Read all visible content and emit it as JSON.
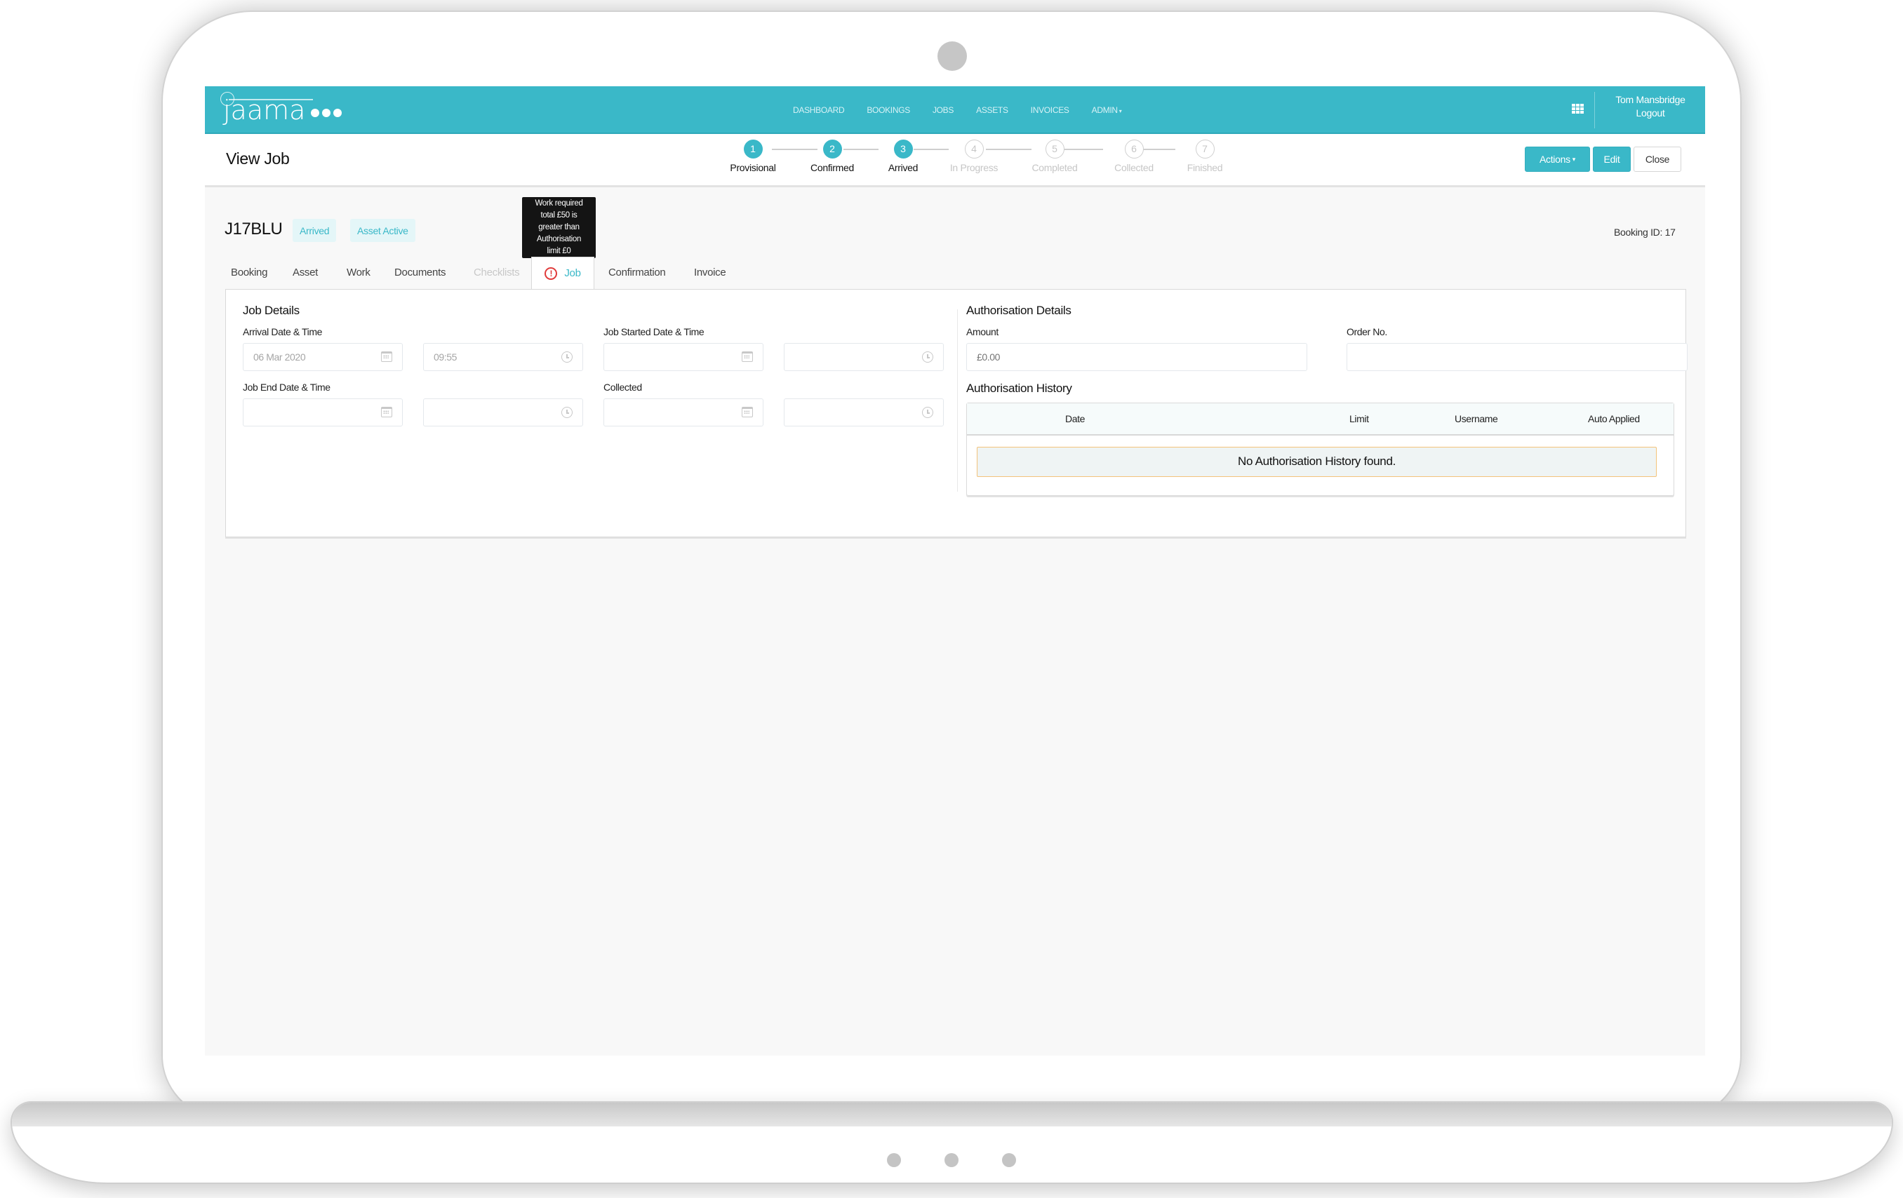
{
  "app": {
    "brand": "jaama",
    "brand_color": "#3ab8c8"
  },
  "nav": {
    "items": [
      {
        "label": "DASHBOARD"
      },
      {
        "label": "BOOKINGS"
      },
      {
        "label": "JOBS"
      },
      {
        "label": "ASSETS"
      },
      {
        "label": "INVOICES"
      },
      {
        "label": "ADMIN",
        "has_dropdown": true
      }
    ],
    "apps_icon": "grid-icon",
    "user_name": "Tom Mansbridge",
    "logout_label": "Logout"
  },
  "subheader": {
    "title": "View Job",
    "steps": [
      {
        "number": "1",
        "label": "Provisional",
        "state": "done"
      },
      {
        "number": "2",
        "label": "Confirmed",
        "state": "done"
      },
      {
        "number": "3",
        "label": "Arrived",
        "state": "done"
      },
      {
        "number": "4",
        "label": "In Progress",
        "state": "todo"
      },
      {
        "number": "5",
        "label": "Completed",
        "state": "todo"
      },
      {
        "number": "6",
        "label": "Collected",
        "state": "todo"
      },
      {
        "number": "7",
        "label": "Finished",
        "state": "todo"
      }
    ],
    "actions_label": "Actions",
    "edit_label": "Edit",
    "close_label": "Close"
  },
  "job": {
    "registration": "J17BLU",
    "badges": [
      "Arrived",
      "Asset Active"
    ],
    "booking_id": "Booking ID: 17",
    "tooltip": [
      "Work required",
      "total £50 is",
      "greater than",
      "Authorisation",
      "limit £0"
    ],
    "tabs": [
      {
        "label": "Booking",
        "state": "normal"
      },
      {
        "label": "Asset",
        "state": "normal"
      },
      {
        "label": "Work",
        "state": "normal"
      },
      {
        "label": "Documents",
        "state": "normal"
      },
      {
        "label": "Checklists",
        "state": "disabled"
      },
      {
        "label": "Job",
        "state": "active",
        "icon": "warning-icon"
      },
      {
        "label": "Confirmation",
        "state": "normal"
      },
      {
        "label": "Invoice",
        "state": "normal"
      }
    ]
  },
  "job_details": {
    "title": "Job Details",
    "arrival_label": "Arrival Date & Time",
    "arrival_date": "06 Mar 2020",
    "arrival_time": "09:55",
    "started_label": "Job Started Date & Time",
    "started_date": "",
    "started_time": "",
    "end_label": "Job End Date & Time",
    "end_date": "",
    "end_time": "",
    "collected_label": "Collected",
    "collected_date": "",
    "collected_time": ""
  },
  "authorisation": {
    "title": "Authorisation Details",
    "amount_label": "Amount",
    "amount_placeholder": "£0.00",
    "order_label": "Order No.",
    "order_value": "",
    "history_title": "Authorisation History",
    "columns": [
      "Date",
      "Limit",
      "Username",
      "Auto Applied"
    ],
    "rows": [],
    "empty_message": "No Authorisation History found."
  }
}
